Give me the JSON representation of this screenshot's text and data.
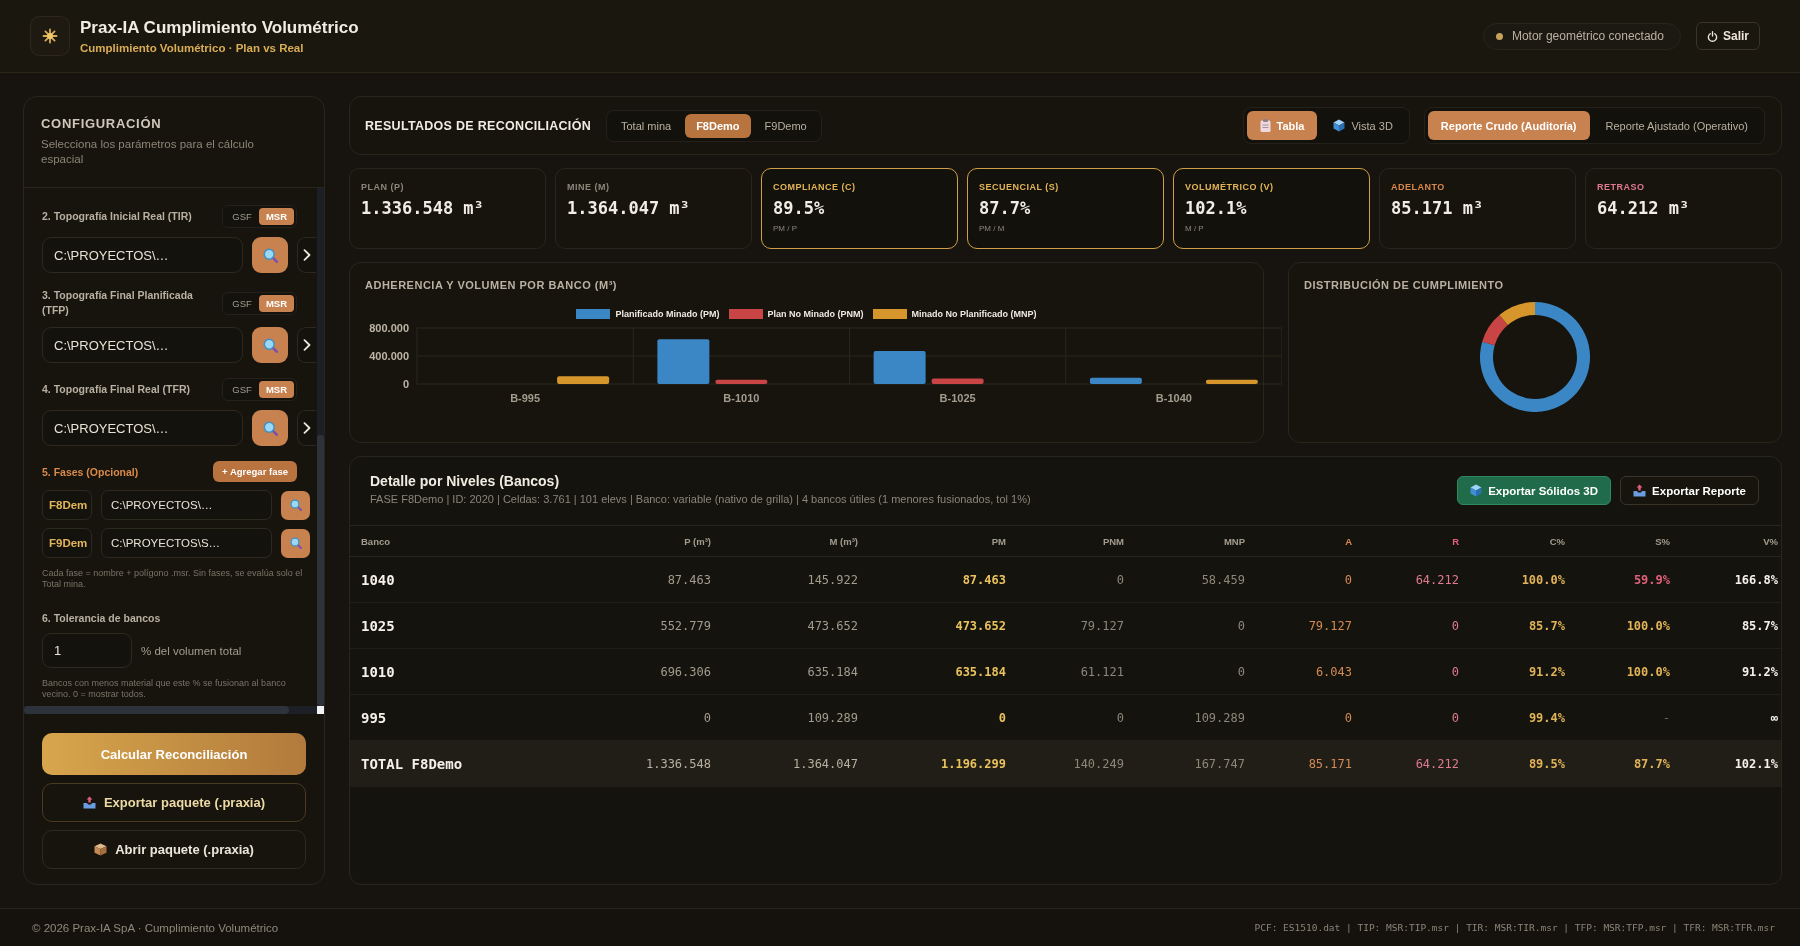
{
  "header": {
    "title": "Prax-IA Cumplimiento Volumétrico",
    "subtitle": "Cumplimiento Volumétrico · Plan vs Real",
    "status": "Motor geométrico conectado",
    "logout": "Salir"
  },
  "config": {
    "title": "CONFIGURACIÓN",
    "subtitle": "Selecciona los parámetros para el cálculo espacial",
    "topographies": [
      {
        "label": "2. Topografía Inicial Real (TIR)",
        "formats": [
          {
            "label": "GSF",
            "selected": false
          },
          {
            "label": "MSR",
            "selected": true
          }
        ],
        "path": "C:\\PROYECTOS\\…"
      },
      {
        "label": "3. Topografía Final Planificada (TFP)",
        "formats": [
          {
            "label": "GSF",
            "selected": false
          },
          {
            "label": "MSR",
            "selected": true
          }
        ],
        "path": "C:\\PROYECTOS\\…"
      },
      {
        "label": "4. Topografía Final Real (TFR)",
        "formats": [
          {
            "label": "GSF",
            "selected": false
          },
          {
            "label": "MSR",
            "selected": true
          }
        ],
        "path": "C:\\PROYECTOS\\…"
      }
    ],
    "phases": {
      "label": "5. Fases (Opcional)",
      "add": "+ Agregar fase",
      "items": [
        {
          "name": "F8Dem",
          "path": "C:\\PROYECTOS\\…"
        },
        {
          "name": "F9Dem",
          "path": "C:\\PROYECTOS\\S…"
        }
      ],
      "hint": "Cada fase = nombre + polígono .msr. Sin fases, se evalúa solo el Total mina."
    },
    "tolerance": {
      "label": "6. Tolerancia de bancos",
      "value": "1",
      "unit": "% del volumen total",
      "hint": "Bancos con menos material que este % se fusionan al banco vecino. 0 = mostrar todos."
    },
    "actions": [
      {
        "label": "Calcular Reconciliación",
        "kind": "primary"
      },
      {
        "label": "Exportar paquete (.praxia)",
        "kind": "accent"
      },
      {
        "label": "Abrir paquete (.praxia)",
        "kind": "plain"
      }
    ]
  },
  "results": {
    "title": "RESULTADOS DE RECONCILIACIÓN",
    "scopes": [
      {
        "label": "Total mina",
        "selected": false
      },
      {
        "label": "F8Demo",
        "selected": true
      },
      {
        "label": "F9Demo",
        "selected": false
      }
    ],
    "views": [
      {
        "label": "Tabla",
        "selected": true
      },
      {
        "label": "Vista 3D",
        "selected": false
      }
    ],
    "reports": [
      {
        "label": "Reporte Crudo (Auditoría)",
        "selected": true
      },
      {
        "label": "Reporte Ajustado (Operativo)",
        "selected": false
      }
    ]
  },
  "kpis": [
    {
      "label": "PLAN (P)",
      "value": "1.336.548 m³",
      "kind": "plain"
    },
    {
      "label": "MINE (M)",
      "value": "1.364.047 m³",
      "kind": "plain"
    },
    {
      "label": "COMPLIANCE (C)",
      "value": "89.5%",
      "note": "PM / P",
      "kind": "ratio"
    },
    {
      "label": "SECUENCIAL (S)",
      "value": "87.7%",
      "note": "PM / M",
      "kind": "ratio"
    },
    {
      "label": "VOLUMÉTRICO (V)",
      "value": "102.1%",
      "note": "M / P",
      "kind": "ratio"
    },
    {
      "label": "ADELANTO",
      "value": "85.171 m³",
      "kind": "ahead"
    },
    {
      "label": "RETRASO",
      "value": "64.212 m³",
      "kind": "behind"
    }
  ],
  "adherence_chart": {
    "chart_data": {
      "type": "bar",
      "title": "ADHERENCIA Y VOLUMEN POR BANCO (M³)",
      "legend": "top",
      "categories": [
        "B-995",
        "B-1010",
        "B-1025",
        "B-1040"
      ],
      "series": [
        {
          "name": "Planificado Minado (PM)",
          "color": "#3b87c6",
          "values": [
            0,
            640,
            470,
            90
          ]
        },
        {
          "name": "Plan No Minado (PNM)",
          "color": "#c94444",
          "values": [
            0,
            60,
            80,
            0
          ]
        },
        {
          "name": "Minado No Planificado (MNP)",
          "color": "#d6962c",
          "values": [
            110,
            0,
            0,
            60
          ]
        }
      ],
      "ylim": [
        0,
        800
      ],
      "yticks": [
        {
          "value": 0,
          "label": "0"
        },
        {
          "value": 400,
          "label": "400.000"
        },
        {
          "value": 800,
          "label": "800.000"
        }
      ]
    }
  },
  "distribution_chart": {
    "chart_data": {
      "type": "donut",
      "title": "DISTRIBUCIÓN DE CUMPLIMIENTO",
      "values": [
        79.5,
        9.3,
        11.2
      ],
      "colors": [
        "#3b87c6",
        "#c94444",
        "#d6962c"
      ]
    }
  },
  "levels": {
    "title": "Detalle por Niveles (Bancos)",
    "summary": "FASE F8Demo | ID: 2020 | Celdas: 3.761 | 101 elevs | Banco: variable (nativo de grilla) | 4 bancos útiles (1 menores fusionados, tol 1%)",
    "buttons": [
      {
        "label": "Exportar Sólidos 3D",
        "kind": "primary"
      },
      {
        "label": "Exportar Reporte",
        "kind": "secondary"
      }
    ],
    "columns": [
      "Banco",
      "P (m³)",
      "M (m³)",
      "PM",
      "PNM",
      "MNP",
      "A",
      "R",
      "C%",
      "S%",
      "V%"
    ],
    "rows": [
      {
        "kind": "bank",
        "s_alert": true,
        "s_na": false,
        "cells": [
          "1040",
          "87.463",
          "145.922",
          "87.463",
          "0",
          "58.459",
          "0",
          "64.212",
          "100.0%",
          "59.9%",
          "166.8%"
        ]
      },
      {
        "kind": "bank",
        "s_alert": false,
        "s_na": false,
        "cells": [
          "1025",
          "552.779",
          "473.652",
          "473.652",
          "79.127",
          "0",
          "79.127",
          "0",
          "85.7%",
          "100.0%",
          "85.7%"
        ]
      },
      {
        "kind": "bank",
        "s_alert": false,
        "s_na": false,
        "cells": [
          "1010",
          "696.306",
          "635.184",
          "635.184",
          "61.121",
          "0",
          "6.043",
          "0",
          "91.2%",
          "100.0%",
          "91.2%"
        ]
      },
      {
        "kind": "bank",
        "s_alert": false,
        "s_na": true,
        "cells": [
          "995",
          "0",
          "109.289",
          "0",
          "0",
          "109.289",
          "0",
          "0",
          "99.4%",
          "-",
          "∞"
        ]
      },
      {
        "kind": "total",
        "s_alert": false,
        "s_na": false,
        "cells": [
          "TOTAL F8Demo",
          "1.336.548",
          "1.364.047",
          "1.196.299",
          "140.249",
          "167.747",
          "85.171",
          "64.212",
          "89.5%",
          "87.7%",
          "102.1%"
        ]
      }
    ]
  },
  "footer": {
    "copyright": "© 2026 Prax-IA SpA · Cumplimiento Volumétrico",
    "sources": "PCF: ES1510.dat | TIP: MSR:TIP.msr | TIR: MSR:TIR.msr | TFP: MSR:TFP.msr | TFR: MSR:TFR.msr"
  }
}
